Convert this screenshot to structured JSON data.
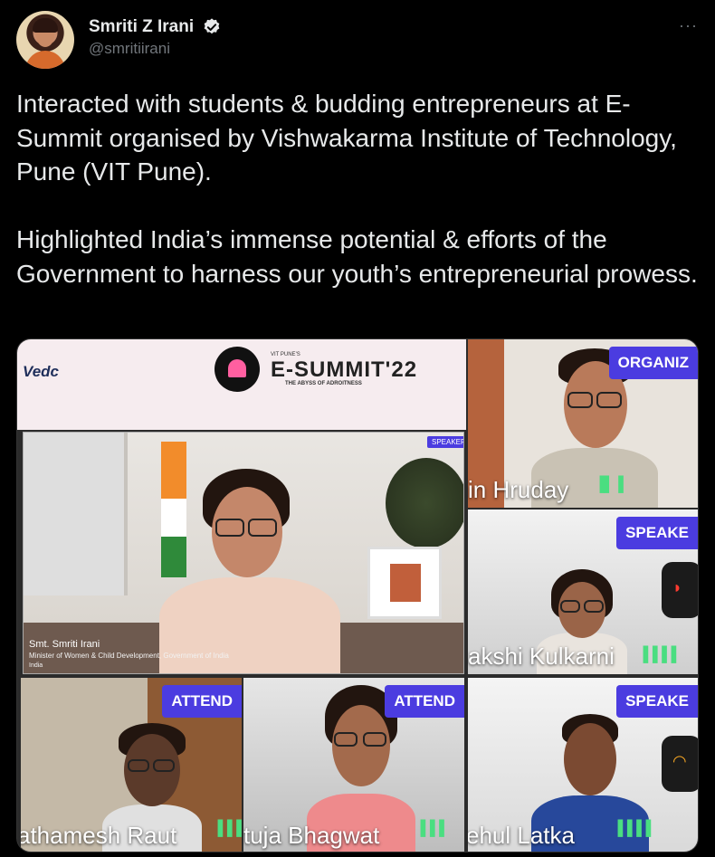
{
  "tweet": {
    "author_name": "Smriti Z Irani",
    "author_handle": "@smritiirani",
    "more_icon": "···",
    "paragraphs": [
      "Interacted with students & budding entrepreneurs at E-Summit organised by Vishwakarma Institute of Technology, Pune (VIT Pune).",
      "Highlighted India’s immense potential & efforts of the Government to harness our youth’s entrepreneurial prowess."
    ]
  },
  "media": {
    "brand": {
      "vedc": "Vedc",
      "small_label": "VIT PUNE'S",
      "title": "E-SUMMIT'22",
      "subtitle": "THE ABYSS OF ADROITNESS"
    },
    "main_speaker": {
      "tag": "SPEAKER",
      "name": "Smt. Smriti Irani",
      "role": "Minister of Women & Child Development, Government of India",
      "extra": "India"
    },
    "tiles": [
      {
        "tag": "ORGANIZ",
        "name": "in Hruday",
        "bars": "▐▌▐"
      },
      {
        "tag": "SPEAKE",
        "name": "akshi Kulkarni",
        "bars": "▐▐▐▐"
      },
      {
        "tag": "ATTEND",
        "name": "athamesh Raut",
        "bars": "▐▐▐▐"
      },
      {
        "tag": "ATTEND",
        "name": "tuja Bhagwat",
        "bars": "▐▐▐"
      },
      {
        "tag": "SPEAKE",
        "name": "ehul Latka",
        "bars": "▐▐▐▐"
      }
    ],
    "colors": {
      "tag_bg": "#4b3ce0",
      "mic_active": "#4ade80",
      "verified": "#e7e9ea"
    },
    "icons": [
      "verified-badge-icon",
      "more-options-icon",
      "mic-level-icon",
      "mic-muted-icon",
      "wifi-icon"
    ]
  }
}
